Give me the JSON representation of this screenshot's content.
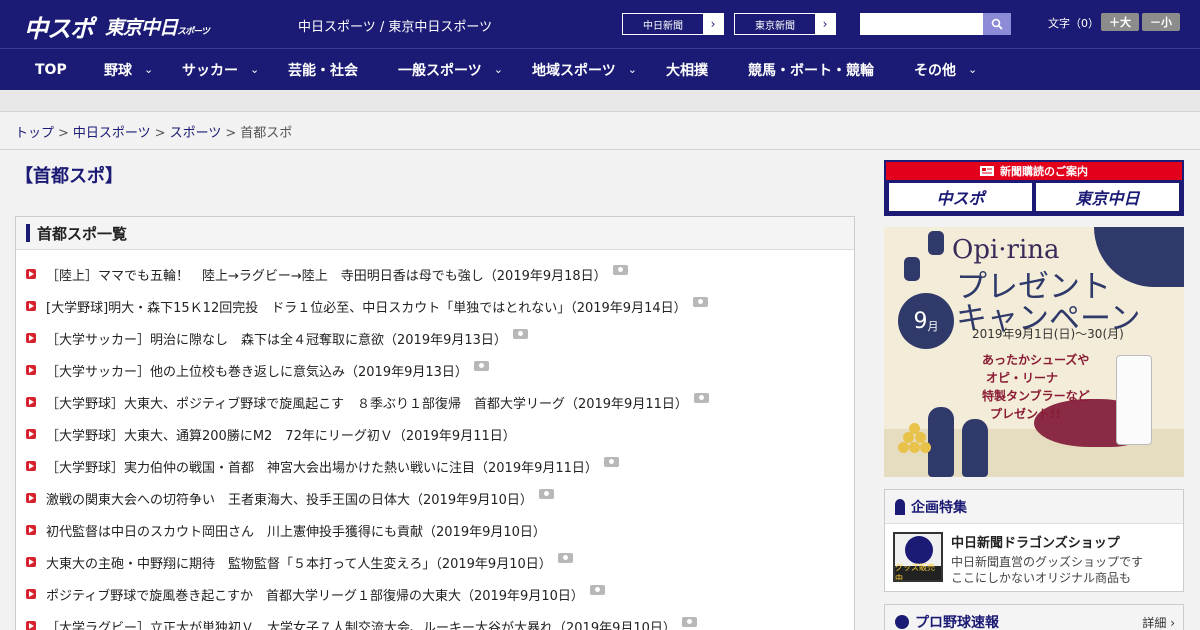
{
  "header": {
    "logo_main": "中スポ",
    "logo_sub": "東京中日",
    "logo_sub_small": "スポーツ",
    "site_title": "中日スポーツ / 東京中日スポーツ",
    "paper_buttons": [
      {
        "label": "中日新聞"
      },
      {
        "label": "東京新聞"
      }
    ],
    "arrow": "›",
    "search": {
      "placeholder": "",
      "value": ""
    },
    "font_size": {
      "label": "文字（0）",
      "bigger": "＋大",
      "smaller": "－小"
    }
  },
  "nav": {
    "items": [
      {
        "label": "TOP"
      },
      {
        "label": "野球"
      },
      {
        "label": "サッカー"
      },
      {
        "label": "芸能・社会"
      },
      {
        "label": "一般スポーツ"
      },
      {
        "label": "地域スポーツ"
      },
      {
        "label": "大相撲"
      },
      {
        "label": "競馬・ボート・競輪"
      },
      {
        "label": "その他"
      }
    ],
    "chevron": "⌄"
  },
  "breadcrumb": {
    "items": [
      "トップ",
      "中日スポーツ",
      "スポーツ",
      "首都スポ"
    ],
    "sep": ">"
  },
  "page_title": "【首都スポ】",
  "list": {
    "heading": "首都スポ一覧",
    "articles": [
      {
        "title": "［陸上］ママでも五輪！　陸上→ラグビー→陸上　寺田明日香は母でも強し（2019年9月18日）",
        "photo": true
      },
      {
        "title": "[大学野球]明大・森下15Ｋ12回完投　ドラ１位必至、中日スカウト「単独ではとれない」（2019年9月14日）",
        "photo": true
      },
      {
        "title": "［大学サッカー］明治に隙なし　森下は全４冠奪取に意欲（2019年9月13日）",
        "photo": true
      },
      {
        "title": "［大学サッカー］他の上位校も巻き返しに意気込み（2019年9月13日）",
        "photo": true
      },
      {
        "title": "［大学野球］大東大、ポジティブ野球で旋風起こす　８季ぶり１部復帰　首都大学リーグ（2019年9月11日）",
        "photo": true
      },
      {
        "title": "［大学野球］大東大、通算200勝にM2　72年にリーグ初Ｖ（2019年9月11日）",
        "photo": false
      },
      {
        "title": "［大学野球］実力伯仲の戦国・首都　神宮大会出場かけた熱い戦いに注目（2019年9月11日）",
        "photo": true
      },
      {
        "title": "激戦の関東大会への切符争い　王者東海大、投手王国の日体大（2019年9月10日）",
        "photo": true
      },
      {
        "title": "初代監督は中日のスカウト岡田さん　川上憲伸投手獲得にも貢献（2019年9月10日）",
        "photo": false
      },
      {
        "title": "大東大の主砲・中野翔に期待　監物監督「５本打って人生変えろ」（2019年9月10日）",
        "photo": true
      },
      {
        "title": "ポジティブ野球で旋風巻き起こすか　首都大学リーグ１部復帰の大東大（2019年9月10日）",
        "photo": true
      },
      {
        "title": "［大学ラグビー］立正大が単独初Ｖ　大学女子７人制交流大会、ルーキー大谷が大暴れ（2019年9月10日）",
        "photo": true
      }
    ]
  },
  "sidebar": {
    "subscription": {
      "heading": "新聞購読のご案内",
      "logo_left": "中スポ",
      "logo_right": "東京中日"
    },
    "banner": {
      "brand": "Opi·rina",
      "title_line1": "プレゼント",
      "title_line2": "キャンペーン",
      "dates": "2019年9月1日(日)〜30(月)",
      "month_num": "9",
      "month_unit": "月",
      "copy1": "あったかシューズや",
      "copy2": "オピ・リーナ",
      "copy3": "特製タンブラーなど",
      "copy4": "プレゼント!!"
    },
    "feature": {
      "heading": "企画特集",
      "img_tag": "グッズ販売中",
      "title": "中日新聞ドラゴンズショップ",
      "desc1": "中日新聞直営のグッズショップです",
      "desc2": "ここにしかないオリジナル商品も"
    },
    "baseball": {
      "heading": "プロ野球速報",
      "more": "詳細 ›"
    }
  },
  "colors": {
    "navy": "#1b1b75",
    "red": "#d8222f",
    "accent": "#e3001b"
  }
}
